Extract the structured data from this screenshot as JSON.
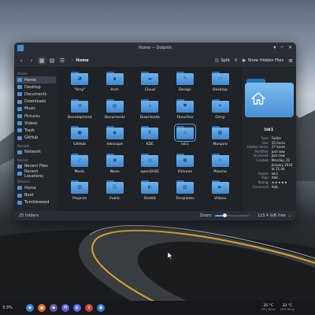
{
  "window": {
    "title": "Home — Dolphin",
    "controls": [
      "▾",
      "─",
      "✕"
    ]
  },
  "toolbar": {
    "location": "Home",
    "split_label": "Split",
    "hidden_files_label": "Show Hidden Files"
  },
  "sidebar": {
    "places_header": "Places",
    "places": [
      {
        "label": "Home",
        "icon": "home-icon",
        "active": true
      },
      {
        "label": "Desktop",
        "icon": "desktop-icon"
      },
      {
        "label": "Documents",
        "icon": "documents-icon"
      },
      {
        "label": "Downloads",
        "icon": "downloads-icon"
      },
      {
        "label": "Music",
        "icon": "music-icon"
      },
      {
        "label": "Pictures",
        "icon": "pictures-icon"
      },
      {
        "label": "Videos",
        "icon": "videos-icon"
      },
      {
        "label": "Trash",
        "icon": "trash-icon"
      },
      {
        "label": "GitHub",
        "icon": "github-icon"
      }
    ],
    "remote_header": "Remote",
    "remote": [
      {
        "label": "Network",
        "icon": "network-icon"
      }
    ],
    "recent_header": "Recent",
    "recent": [
      {
        "label": "Recent Files",
        "icon": "recent-files-icon"
      },
      {
        "label": "Recent Locations",
        "icon": "recent-locations-icon"
      }
    ],
    "devices_header": "Devices",
    "devices": [
      {
        "label": "Home",
        "icon": "drive-icon"
      },
      {
        "label": "Boot",
        "icon": "drive-icon"
      },
      {
        "label": "Tumbleweed",
        "icon": "drive-icon"
      }
    ]
  },
  "folders": [
    {
      "label": "\"Amy\"",
      "glyph": "◕"
    },
    {
      "label": "Arch",
      "glyph": "▲"
    },
    {
      "label": "Cloud",
      "glyph": "☁"
    },
    {
      "label": "Design",
      "glyph": "✎"
    },
    {
      "label": "Desktop",
      "glyph": "▭"
    },
    {
      "label": "Development",
      "glyph": "⚙"
    },
    {
      "label": "Documents",
      "glyph": "▤"
    },
    {
      "label": "Downloads",
      "glyph": "↓"
    },
    {
      "label": "Favorites",
      "glyph": "♥"
    },
    {
      "label": "Gimp",
      "glyph": "✦"
    },
    {
      "label": "GitHub",
      "glyph": "●"
    },
    {
      "label": "Inkscape",
      "glyph": "◆"
    },
    {
      "label": "KDE",
      "glyph": "K"
    },
    {
      "label": "lxk1",
      "glyph": "⌂"
    },
    {
      "label": "Manjaro",
      "glyph": "▦"
    },
    {
      "label": "Music",
      "glyph": "♪"
    },
    {
      "label": "Neon",
      "glyph": "◉"
    },
    {
      "label": "openSUSE",
      "glyph": "◎"
    },
    {
      "label": "Pictures",
      "glyph": "▣"
    },
    {
      "label": "Plasma",
      "glyph": "✧"
    },
    {
      "label": "Projects",
      "glyph": "▥"
    },
    {
      "label": "Public",
      "glyph": "☺"
    },
    {
      "label": "Reddit",
      "glyph": "◐"
    },
    {
      "label": "Templates",
      "glyph": "▧"
    },
    {
      "label": "Videos",
      "glyph": "▶"
    }
  ],
  "selected_folder_index": 13,
  "info_panel": {
    "name": "lxk1",
    "rows": [
      {
        "k": "Type:",
        "v": "Folder"
      },
      {
        "k": "Size:",
        "v": "25 items"
      },
      {
        "k": "Hidden items:",
        "v": "27 items"
      },
      {
        "k": "Modified:",
        "v": "Just now"
      },
      {
        "k": "Accessed:",
        "v": "Just now"
      },
      {
        "k": "Created:",
        "v": "Monday, 22 January 2024 at 21:44"
      },
      {
        "k": "Owner:",
        "v": "lxk1"
      },
      {
        "k": "Tags:",
        "v": "Add..."
      },
      {
        "k": "Rating:",
        "v": "★★★★★"
      },
      {
        "k": "Comment:",
        "v": "Add..."
      }
    ]
  },
  "statusbar": {
    "count": "25 folders",
    "zoom_label": "Zoom:",
    "zoom_level": 0.28,
    "free_space": "123.4 GiB free"
  },
  "taskbar": {
    "cpu_usage": "3.3%",
    "apps": [
      {
        "name": "chromium-icon",
        "color": "#3b7ed6",
        "glyph": "◉"
      },
      {
        "name": "firefox-icon",
        "color": "#e06a2c",
        "glyph": "◕"
      },
      {
        "name": "inkscape-icon",
        "color": "#6c5b9e",
        "glyph": "◆"
      },
      {
        "name": "mastodon-icon",
        "color": "#5a5fd6",
        "glyph": "M"
      },
      {
        "name": "discord-icon",
        "color": "#5865f2",
        "glyph": "◐"
      },
      {
        "name": "vivaldi-icon",
        "color": "#c8433a",
        "glyph": "V"
      },
      {
        "name": "dolphin-icon",
        "color": "#2f7fd0",
        "glyph": "▣"
      }
    ],
    "cpu_temp": {
      "value": "35 °C",
      "label": "CPU Temp"
    },
    "gpu_temp": {
      "value": "33 °C",
      "label": "GPU Temp"
    }
  },
  "colors": {
    "accent": "#5aa6f0",
    "folder": "#4a90d6"
  }
}
